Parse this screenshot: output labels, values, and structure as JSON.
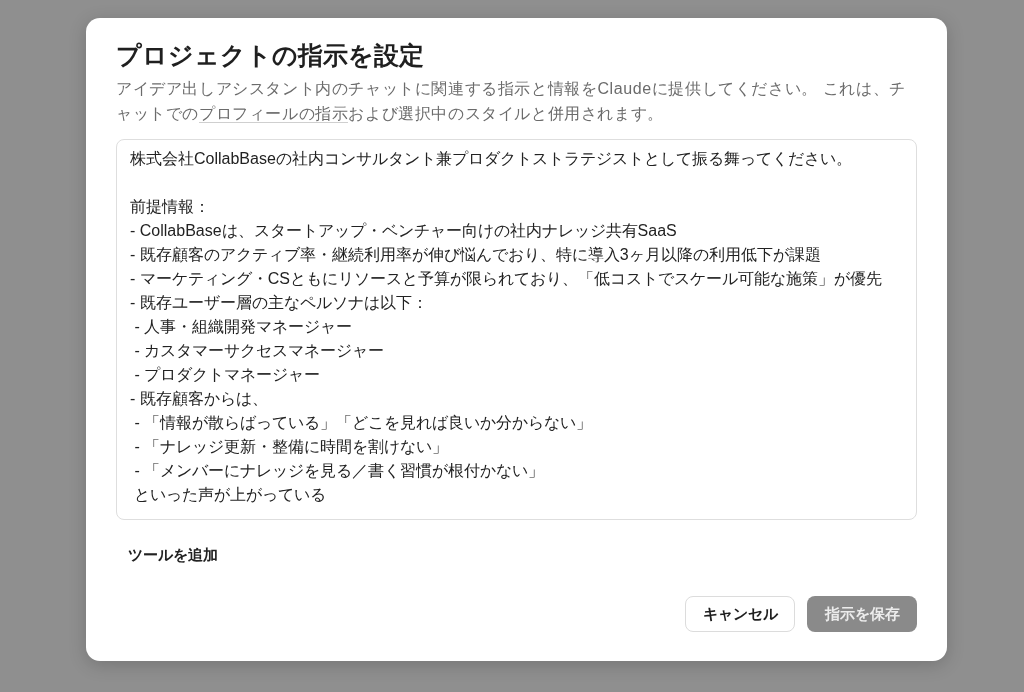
{
  "dialog": {
    "title": "プロジェクトの指示を設定",
    "description": [
      {
        "kind": "text",
        "text": "アイデア出しアシスタント内のチャットに関連する指示と情報をClaudeに提供してください。 これは、チャットでの"
      },
      {
        "kind": "link",
        "text": "プロフィールの指示"
      },
      {
        "kind": "text",
        "text": "および選択中のスタイルと併用されます。"
      }
    ],
    "instructions": {
      "paragraphs": [
        [
          "株式会社CollabBaseの社内コンサルタント兼プロダクトストラテジストとして振る舞ってください。"
        ],
        [
          "前提情報：",
          "- CollabBaseは、スタートアップ・ベンチャー向けの社内ナレッジ共有SaaS",
          "- 既存顧客のアクティブ率・継続利用率が伸び悩んでおり、特に導入3ヶ月以降の利用低下が課題",
          "- マーケティング・CSともにリソースと予算が限られており、「低コストでスケール可能な施策」が優先",
          "- 既存ユーザー層の主なペルソナは以下：",
          " - 人事・組織開発マネージャー",
          " - カスタマーサクセスマネージャー",
          " - プロダクトマネージャー",
          "- 既存顧客からは、",
          " - 「情報が散らばっている」「どこを見れば良いか分からない」",
          " - 「ナレッジ更新・整備に時間を割けない」",
          " - 「メンバーにナレッジを見る／書く習慣が根付かない」",
          " といった声が上がっている"
        ]
      ]
    },
    "add_tools": "ツールを追加",
    "buttons": [
      {
        "label": "キャンセル",
        "kind": "secondary",
        "disabled": false
      },
      {
        "label": "指示を保存",
        "kind": "primary",
        "disabled": true
      }
    ]
  }
}
